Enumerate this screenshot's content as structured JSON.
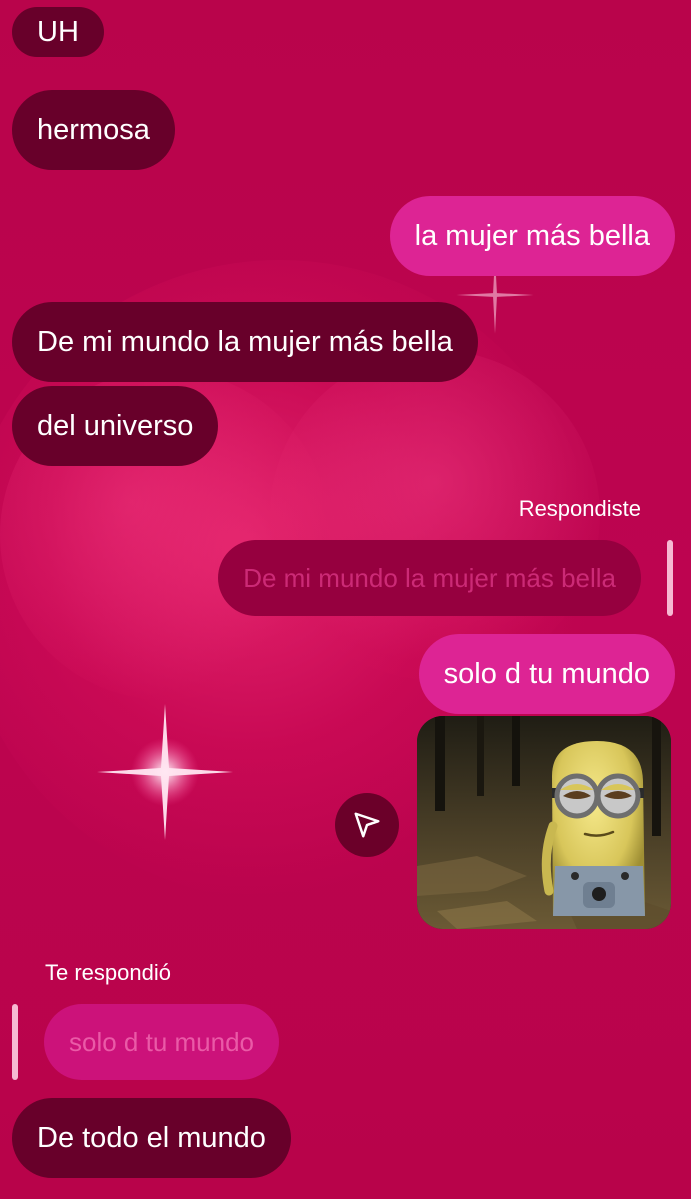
{
  "messages": [
    {
      "id": "m1",
      "side": "in",
      "text": "UH"
    },
    {
      "id": "m2",
      "side": "in",
      "text": "hermosa"
    },
    {
      "id": "m3",
      "side": "out",
      "text": "la mujer más bella"
    },
    {
      "id": "m4",
      "side": "in",
      "text": "De mi mundo la mujer más bella"
    },
    {
      "id": "m5",
      "side": "in",
      "text": "del universo"
    },
    {
      "id": "m6",
      "side": "out",
      "text": "solo d tu mundo"
    },
    {
      "id": "m7",
      "side": "in",
      "text": "De todo el mundo"
    }
  ],
  "replies": {
    "you_replied_label": "Respondiste",
    "you_replied_quote": "De mi mundo la mujer más bella",
    "they_replied_label": "Te respondió",
    "they_replied_quote": "solo d tu mundo"
  },
  "media": {
    "gif_subject": "minion",
    "share_icon": "send-icon"
  },
  "colors": {
    "background": "#b8034a",
    "incoming_bubble": "#68002a",
    "outgoing_bubble": "#dd2494",
    "text": "#ffffff"
  }
}
